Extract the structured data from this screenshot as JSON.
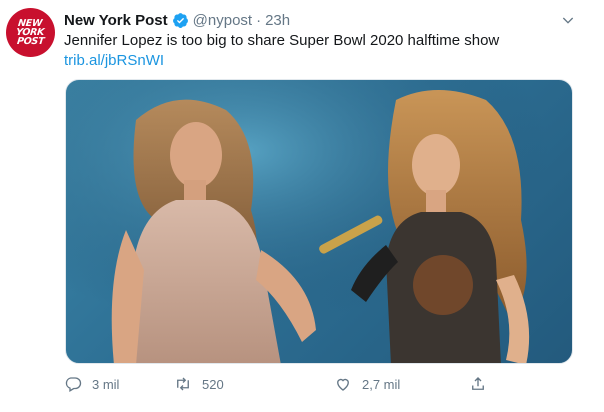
{
  "tweet": {
    "author_name": "New York Post",
    "handle": "@nypost",
    "separator": "·",
    "time": "23h",
    "avatar_text": [
      "NEW",
      "YORK",
      "POST"
    ],
    "text": "Jennifer Lopez is too big to share Super Bowl 2020 halftime show",
    "link": "trib.al/jbRSnWI"
  },
  "actions": {
    "reply_count": "3 mil",
    "retweet_count": "520",
    "like_count": "2,7 mil"
  },
  "icons": {
    "verified": "verified-badge-icon",
    "caret": "chevron-down-icon",
    "reply": "reply-icon",
    "retweet": "retweet-icon",
    "like": "heart-icon",
    "share": "share-icon"
  },
  "colors": {
    "accent": "#1b95e0",
    "verified": "#1da1f2",
    "avatar_bg": "#c8102e",
    "muted": "#657786"
  }
}
